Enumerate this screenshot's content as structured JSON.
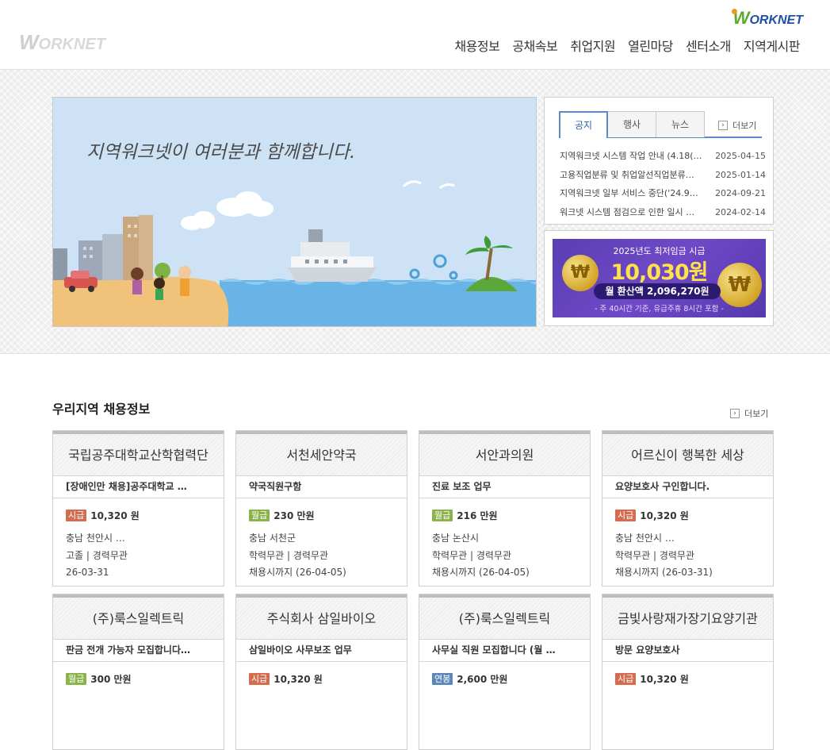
{
  "header": {
    "logo_left": "WORKNET",
    "logo_right": "WORKNET",
    "nav": [
      "채용정보",
      "공채속보",
      "취업지원",
      "열린마당",
      "센터소개",
      "지역게시판"
    ]
  },
  "hero": {
    "headline": "지역워크넷이 여러분과 함께합니다."
  },
  "notice": {
    "tabs": [
      "공지",
      "행사",
      "뉴스"
    ],
    "active_tab": 0,
    "more_label": "더보기",
    "items": [
      {
        "title": "지역워크넷 시스템 작업 안내 (4.18(…",
        "date": "2025-04-15"
      },
      {
        "title": "고용직업분류 및 취업알선직업분류…",
        "date": "2025-01-14"
      },
      {
        "title": "지역워크넷 일부 서비스 중단('24.9…",
        "date": "2024-09-21"
      },
      {
        "title": "워크넷 시스템 점검으로 인한 일시 …",
        "date": "2024-02-14"
      }
    ]
  },
  "wage_banner": {
    "line1": "2025년도 최저임금 시급",
    "amount": "10,030원",
    "monthly": "월 환산액 2,096,270원",
    "note": "- 주 40시간 기준, 유급주휴 8시간 포함 -",
    "coin_symbol": "₩"
  },
  "jobs": {
    "title": "우리지역 채용정보",
    "more_label": "더보기",
    "cards": [
      {
        "company": "국립공주대학교산학협력단",
        "title": "[장애인만 채용]공주대학교 …",
        "pay_type": "시급",
        "pay_kind": "hourly",
        "pay": "10,320 원",
        "loc": "충남 천안시 …",
        "req": "고졸 | 경력무관",
        "deadline": "26-03-31"
      },
      {
        "company": "서천세안약국",
        "title": "약국직원구함",
        "pay_type": "월급",
        "pay_kind": "monthly",
        "pay": "230 만원",
        "loc": "충남 서천군",
        "req": "학력무관 | 경력무관",
        "deadline": "채용시까지 (26-04-05)"
      },
      {
        "company": "서안과의원",
        "title": "진료 보조 업무",
        "pay_type": "월급",
        "pay_kind": "monthly",
        "pay": "216 만원",
        "loc": "충남 논산시",
        "req": "학력무관 | 경력무관",
        "deadline": "채용시까지 (26-04-05)"
      },
      {
        "company": "어르신이 행복한 세상",
        "title": "요양보호사 구인합니다.",
        "pay_type": "시급",
        "pay_kind": "hourly",
        "pay": "10,320 원",
        "loc": "충남 천안시 …",
        "req": "학력무관 | 경력무관",
        "deadline": "채용시까지 (26-03-31)"
      },
      {
        "company": "(주)룩스일렉트릭",
        "title": "판금 전개 가능자 모집합니다…",
        "pay_type": "월급",
        "pay_kind": "monthly",
        "pay": "300 만원",
        "loc": "",
        "req": "",
        "deadline": ""
      },
      {
        "company": "주식회사 삼일바이오",
        "title": "삼일바이오 사무보조 업무",
        "pay_type": "시급",
        "pay_kind": "hourly",
        "pay": "10,320 원",
        "loc": "",
        "req": "",
        "deadline": ""
      },
      {
        "company": "(주)룩스일렉트릭",
        "title": "사무실 직원 모집합니다 (월 …",
        "pay_type": "연봉",
        "pay_kind": "yearly",
        "pay": "2,600 만원",
        "loc": "",
        "req": "",
        "deadline": ""
      },
      {
        "company": "금빛사랑재가장기요양기관",
        "title": "방문 요양보호사",
        "pay_type": "시급",
        "pay_kind": "hourly",
        "pay": "10,320 원",
        "loc": "",
        "req": "",
        "deadline": ""
      }
    ]
  }
}
